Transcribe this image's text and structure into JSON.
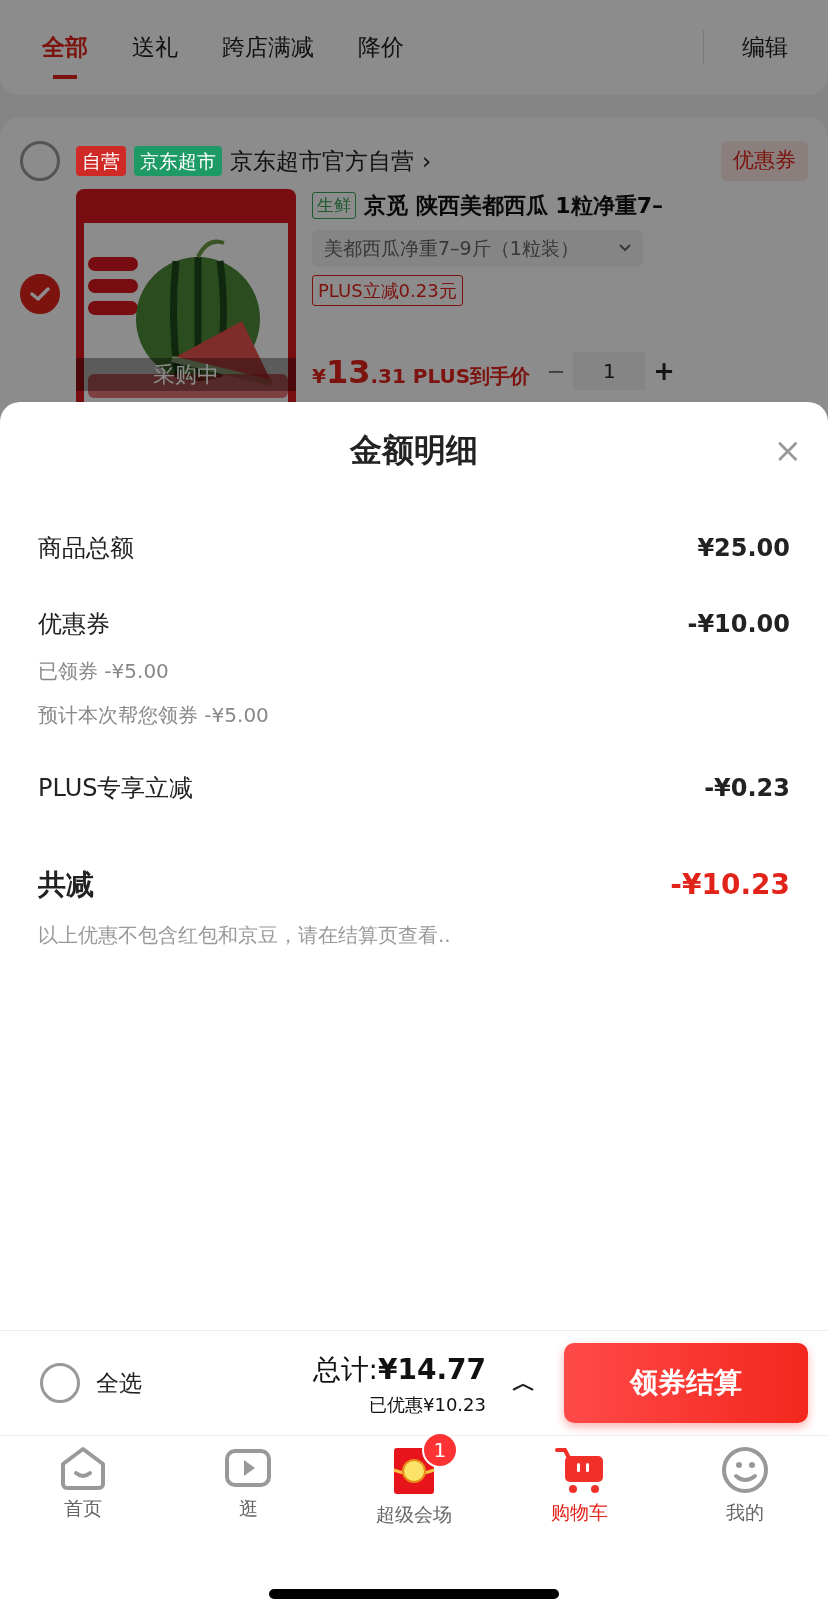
{
  "filter_tabs": [
    {
      "label": "全部",
      "selected": true
    },
    {
      "label": "送礼",
      "selected": false
    },
    {
      "label": "跨店满减",
      "selected": false
    },
    {
      "label": "降价",
      "selected": false
    }
  ],
  "edit_button": "编辑",
  "store": {
    "checked": false,
    "tags": [
      {
        "label": "自营",
        "color": "#d02a26"
      },
      {
        "label": "京东超市",
        "color": "#1e9a66"
      }
    ],
    "name": "京东超市官方自营",
    "chevron": "›",
    "coupon_button": "优惠券"
  },
  "product": {
    "checked": true,
    "image_label": "采购中",
    "tag": "生鲜",
    "title": "京觅 陕西美都西瓜 1粒净重7–",
    "spec": "美都西瓜净重7–9斤（1粒装）",
    "promo": "PLUS立减0.23元",
    "price_currency": "¥",
    "price_int": "13",
    "price_dec": ".31",
    "price_note": "PLUS到手价",
    "minus": "−",
    "quantity": "1",
    "plus": "+"
  },
  "sheet": {
    "title": "金额明细",
    "close": "×",
    "rows": [
      {
        "kind": "plain",
        "label": "商品总额",
        "value": "¥25.00"
      },
      {
        "kind": "plain",
        "label": "优惠券",
        "value": "-¥10.00",
        "details": [
          "已领券 -¥5.00",
          "预计本次帮您领券 -¥5.00"
        ]
      },
      {
        "kind": "plain",
        "label": "PLUS专享立减",
        "value": "-¥0.23"
      },
      {
        "kind": "total",
        "label": "共减",
        "value": "-¥10.23"
      }
    ],
    "note": "以上优惠不包含红包和京豆，请在结算页查看.."
  },
  "bottom_bar": {
    "select_all": {
      "label": "全选",
      "checked": false
    },
    "total_label": "总计:",
    "total": "¥14.77",
    "saved": "已优惠¥10.23",
    "expand": "︿",
    "checkout": "领券结算"
  },
  "nav": [
    {
      "kind": "home",
      "label": "首页",
      "selected": false
    },
    {
      "kind": "play",
      "label": "逛",
      "selected": false
    },
    {
      "kind": "packet",
      "label": "超级会场",
      "selected": false,
      "badge": "1"
    },
    {
      "kind": "cart",
      "label": "购物车",
      "selected": true
    },
    {
      "kind": "face",
      "label": "我的",
      "selected": false
    }
  ]
}
